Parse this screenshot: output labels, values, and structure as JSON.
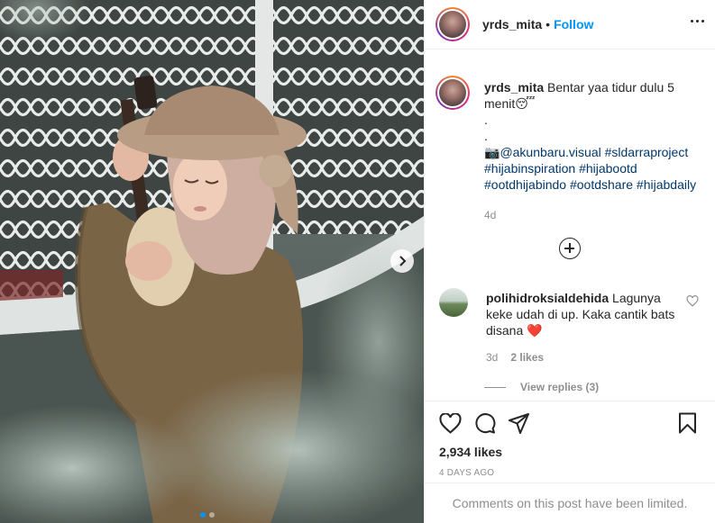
{
  "post": {
    "username": "yrds_mita",
    "separator": "•",
    "follow_label": "Follow",
    "more_icon": "more-horizontal-icon"
  },
  "caption": {
    "username": "yrds_mita",
    "text_line1": "Bentar yaa tidur dulu 5 menit",
    "emoji": "😴",
    "dot1": ".",
    "dot2": ".",
    "camera_emoji": "📷",
    "mention": "@akunbaru.visual",
    "tags_line1": "#sldarraproject",
    "tags_line2": "#hijabinspiration #hijabootd",
    "tags_line3": "#ootdhijabindo #ootdshare #hijabdaily",
    "age": "4d"
  },
  "comment": {
    "username": "polihidroksialdehida",
    "text": "Lagunya keke udah di up. Kaka cantik bats disana",
    "emoji": "❤️",
    "age": "3d",
    "likes": "2 likes",
    "view_replies": "View replies (3)"
  },
  "footer": {
    "likes": "2,934 likes",
    "date": "4 DAYS AGO",
    "limited_notice": "Comments on this post have been limited."
  },
  "carousel": {
    "dots": 2,
    "active_index": 0
  },
  "colors": {
    "accent": "#0095f6",
    "muted": "#8e8e8e",
    "heart": "#ed4956"
  }
}
